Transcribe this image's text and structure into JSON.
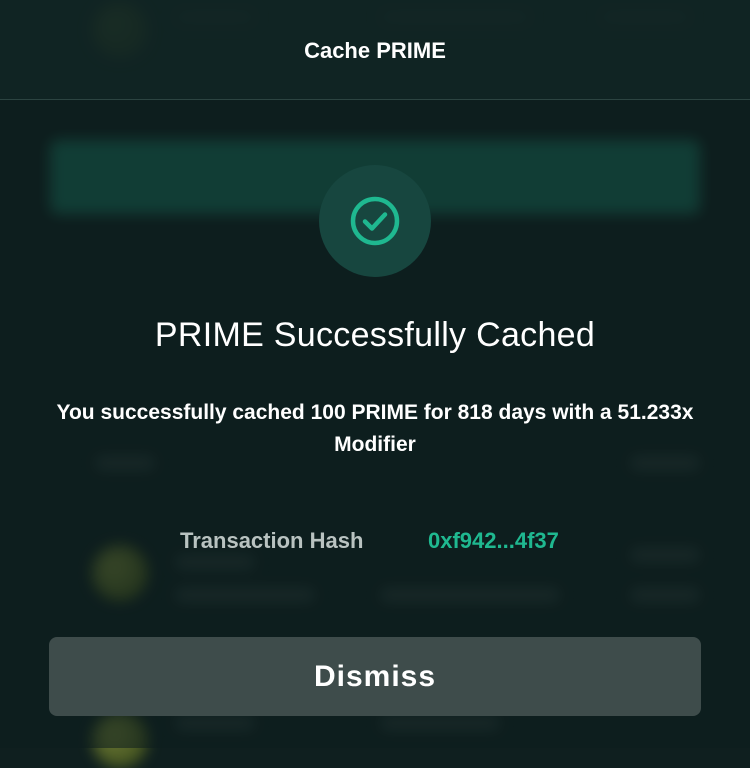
{
  "modal": {
    "title": "Cache PRIME",
    "success_title": "PRIME Successfully Cached",
    "success_description": "You successfully cached 100 PRIME for 818 days with a 51.233x Modifier",
    "transaction": {
      "label": "Transaction Hash",
      "value": "0xf942...4f37"
    },
    "dismiss_label": "Dismiss",
    "icon": "check-circle-icon"
  },
  "colors": {
    "accent": "#1fb890",
    "background": "#0f1f1f",
    "button": "#3e4c4b"
  }
}
